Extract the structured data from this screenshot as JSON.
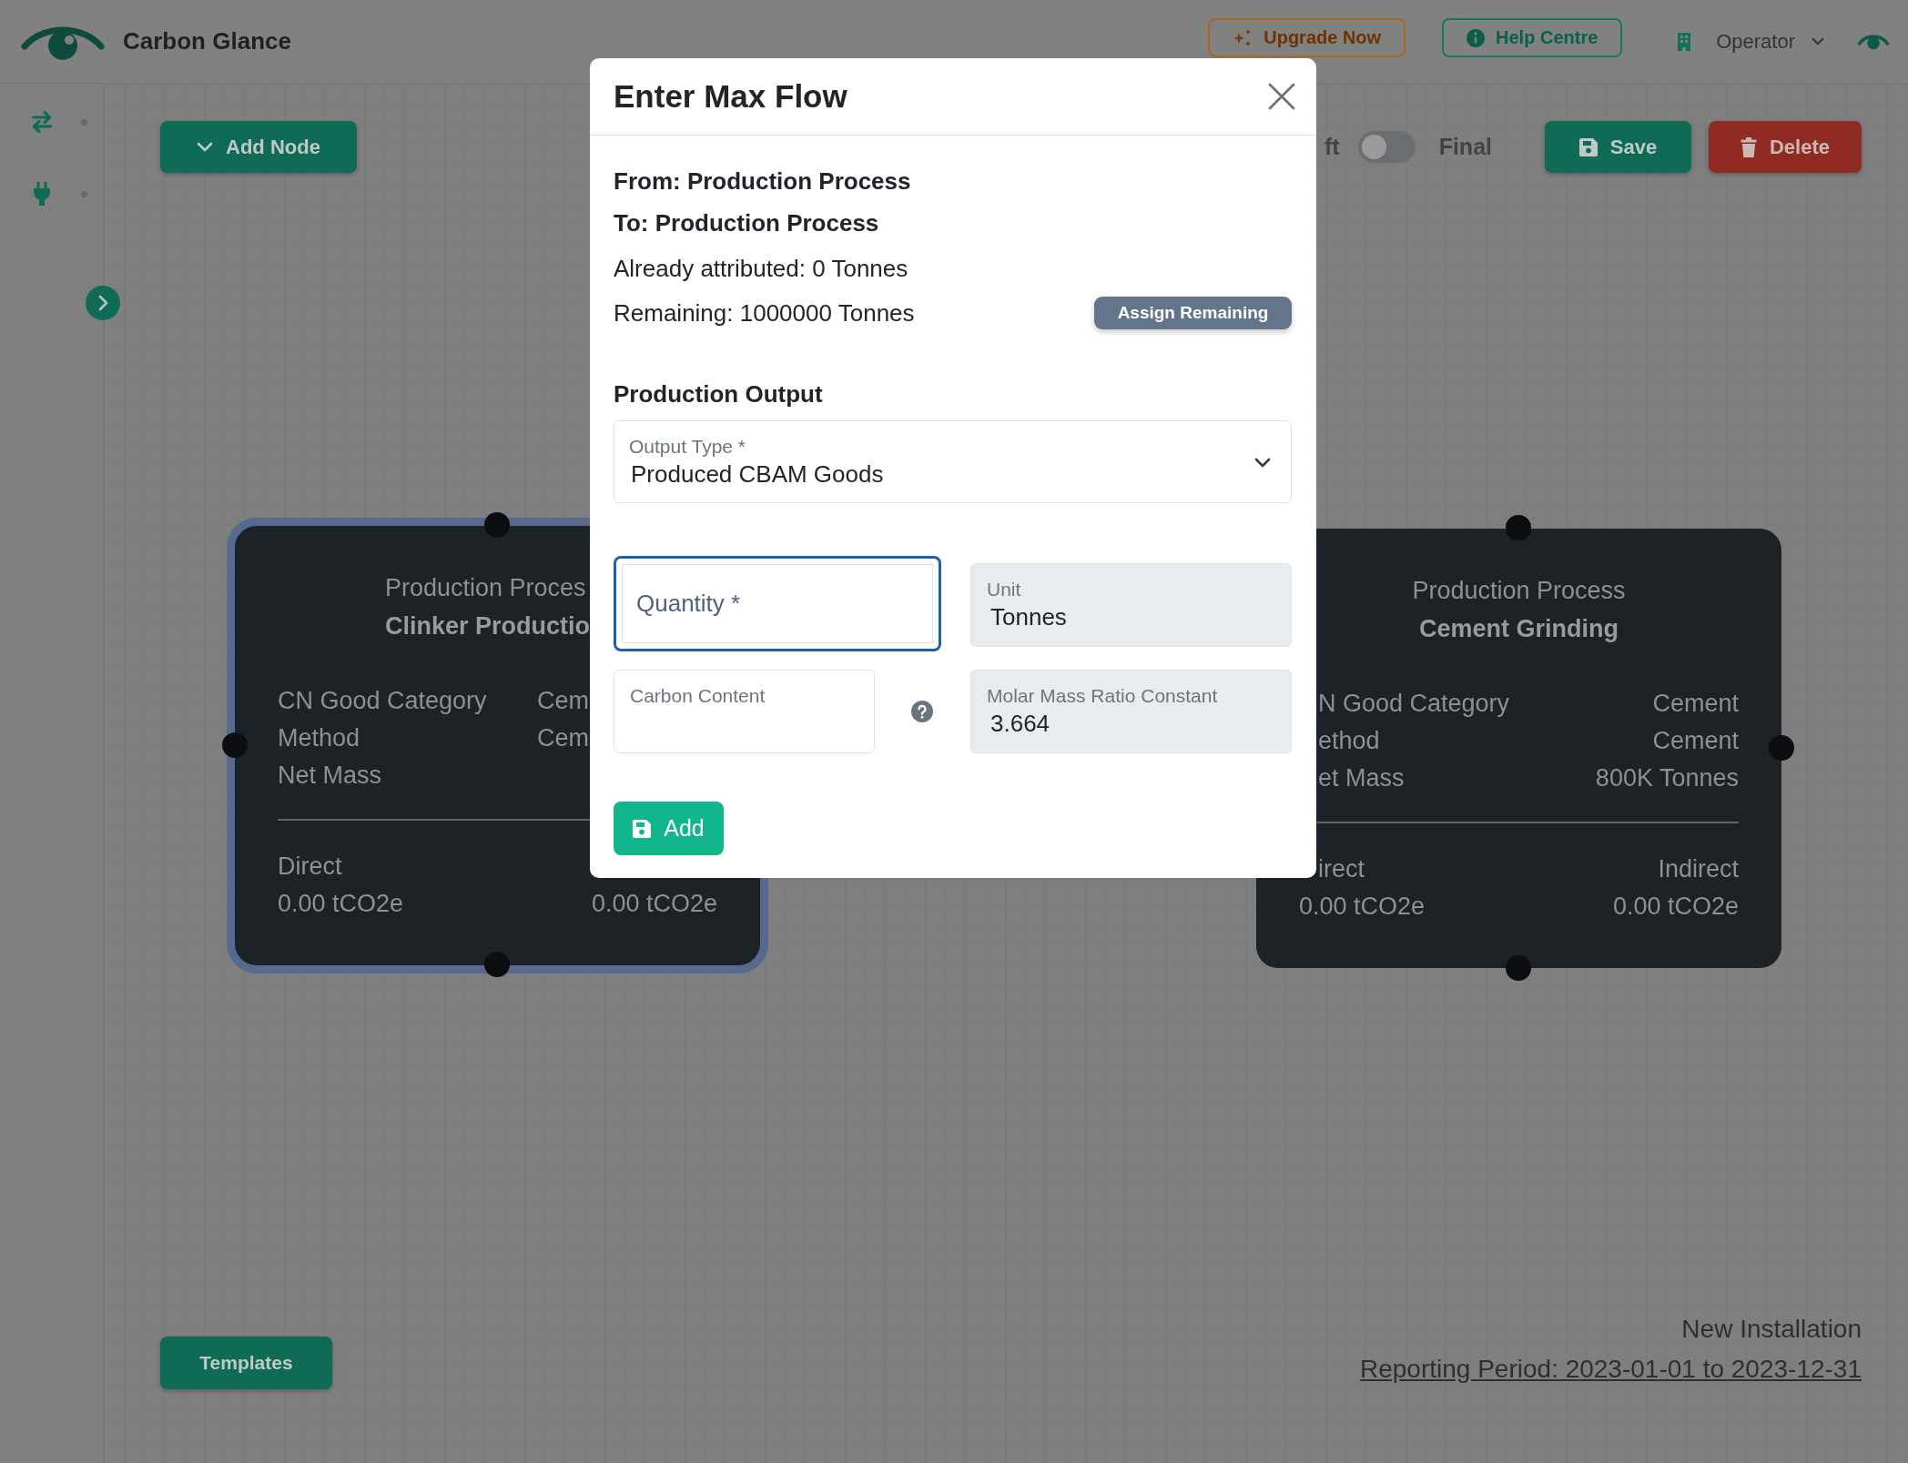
{
  "header": {
    "app_name": "Carbon Glance",
    "upgrade_button": "Upgrade Now",
    "help_button": "Help Centre",
    "role_menu": "Operator"
  },
  "toolbar": {
    "add_node_button": "Add Node",
    "mode_toggle": {
      "left_label": "ft",
      "right_label": "Final",
      "on": false
    },
    "save_button": "Save",
    "delete_button": "Delete"
  },
  "nodes": [
    {
      "selected": true,
      "type": "Production Proces",
      "name": "Clinker Productio",
      "properties": [
        {
          "label": "CN Good Category",
          "value": "Cem"
        },
        {
          "label": "Method",
          "value": "Cem"
        },
        {
          "label": "Net Mass"
        }
      ],
      "emissions": [
        {
          "label": "Direct",
          "value": "0.00 tCO2e"
        },
        {
          "value": "0.00 tCO2e"
        }
      ]
    },
    {
      "selected": false,
      "type": "Production Process",
      "name": "Cement Grinding",
      "properties": [
        {
          "label": "N Good Category",
          "value": "Cement"
        },
        {
          "label": "ethod",
          "value": "Cement"
        },
        {
          "label": "et Mass",
          "value": "800K Tonnes"
        }
      ],
      "emissions": [
        {
          "label": "irect",
          "value": "0.00 tCO2e"
        },
        {
          "label": "Indirect",
          "value": "0.00 tCO2e"
        }
      ]
    }
  ],
  "footer": {
    "templates_button": "Templates",
    "installation": "New Installation",
    "reporting_period": "Reporting Period: 2023-01-01 to 2023-12-31"
  },
  "modal": {
    "title": "Enter Max Flow",
    "from": "From: Production Process",
    "to": "To: Production Process",
    "attributed": "Already attributed: 0 Tonnes",
    "remaining": "Remaining: 1000000 Tonnes",
    "assign_button": "Assign Remaining",
    "section_title": "Production Output",
    "output_type": {
      "label": "Output Type *",
      "value": "Produced CBAM Goods"
    },
    "field_rows": [
      [
        {
          "placeholder": "Quantity *",
          "focused": true,
          "disabled": false,
          "help": false
        },
        {
          "label": "Unit",
          "value": "Tonnes",
          "focused": false,
          "disabled": true,
          "help": false
        }
      ],
      [
        {
          "label": "Carbon Content",
          "focused": false,
          "disabled": false,
          "help": true
        },
        {
          "label": "Molar Mass Ratio Constant",
          "value": "3.664",
          "focused": false,
          "disabled": true,
          "help": false
        }
      ]
    ],
    "add_button": "Add"
  }
}
